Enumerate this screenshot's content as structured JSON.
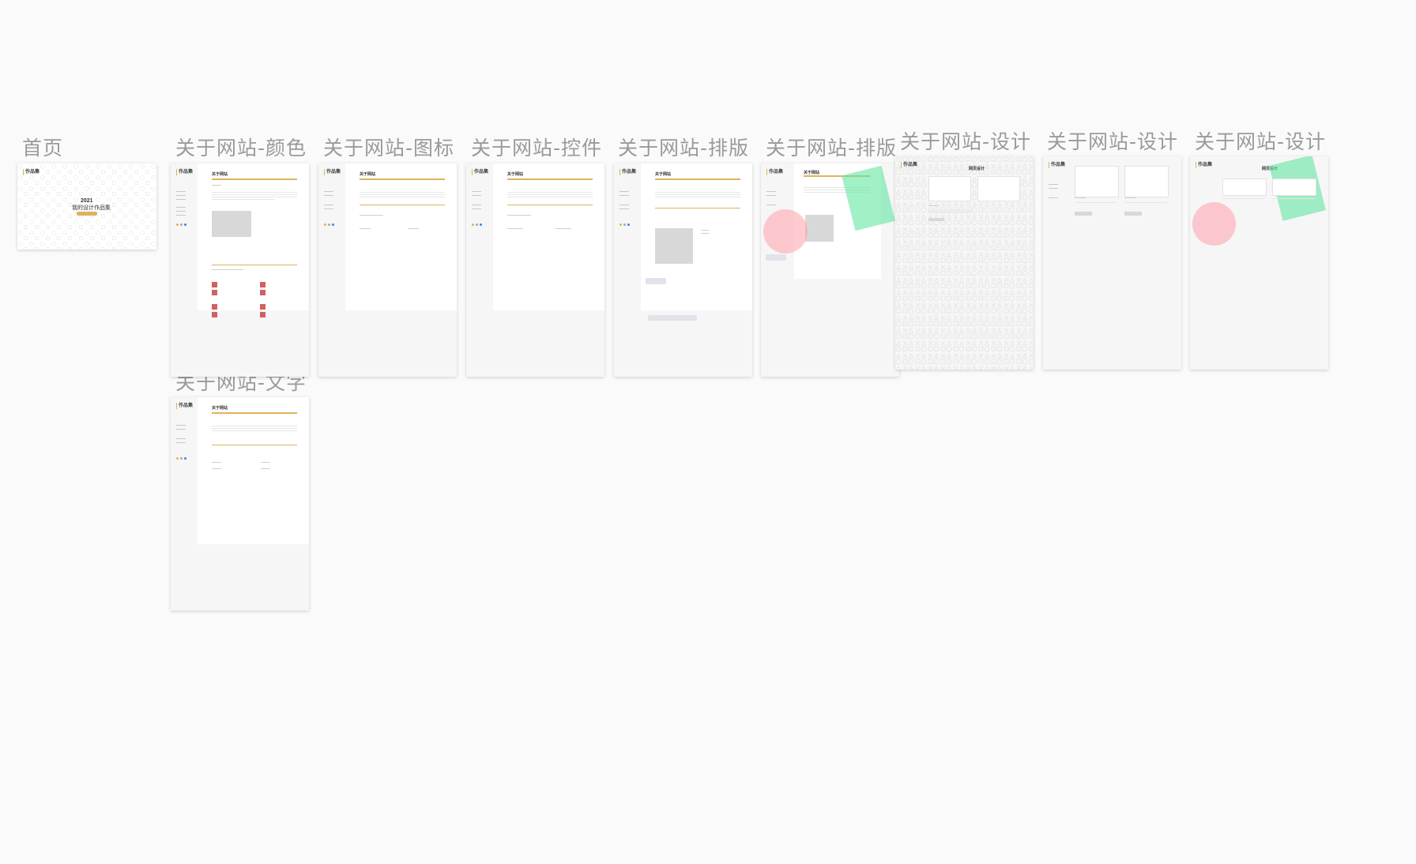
{
  "frames": [
    {
      "id": "home",
      "title": "首页"
    },
    {
      "id": "colors",
      "title": "关于网站-颜色"
    },
    {
      "id": "icons",
      "title": "关于网站-图标"
    },
    {
      "id": "controls",
      "title": "关于网站-控件"
    },
    {
      "id": "layout1",
      "title": "关于网站-排版"
    },
    {
      "id": "layout2",
      "title": "关于网站-排版"
    },
    {
      "id": "design1",
      "title": "关于网站-设计"
    },
    {
      "id": "design2",
      "title": "关于网站-设计"
    },
    {
      "id": "design3",
      "title": "关于网站-设计"
    },
    {
      "id": "text",
      "title": "关于网站-文字"
    }
  ],
  "mini": {
    "logo": "作品集",
    "about_heading": "关于网站",
    "design_heading": "网页设计",
    "cover_year": "2021",
    "cover_subtitle": "我的设计作品集"
  },
  "colors": {
    "accent": "#e0b25c",
    "red_swatch": "#d16060",
    "pink_blob": "#ffa0aa",
    "green_blob": "#64e6a0",
    "title_gray": "#9a9a9a"
  }
}
